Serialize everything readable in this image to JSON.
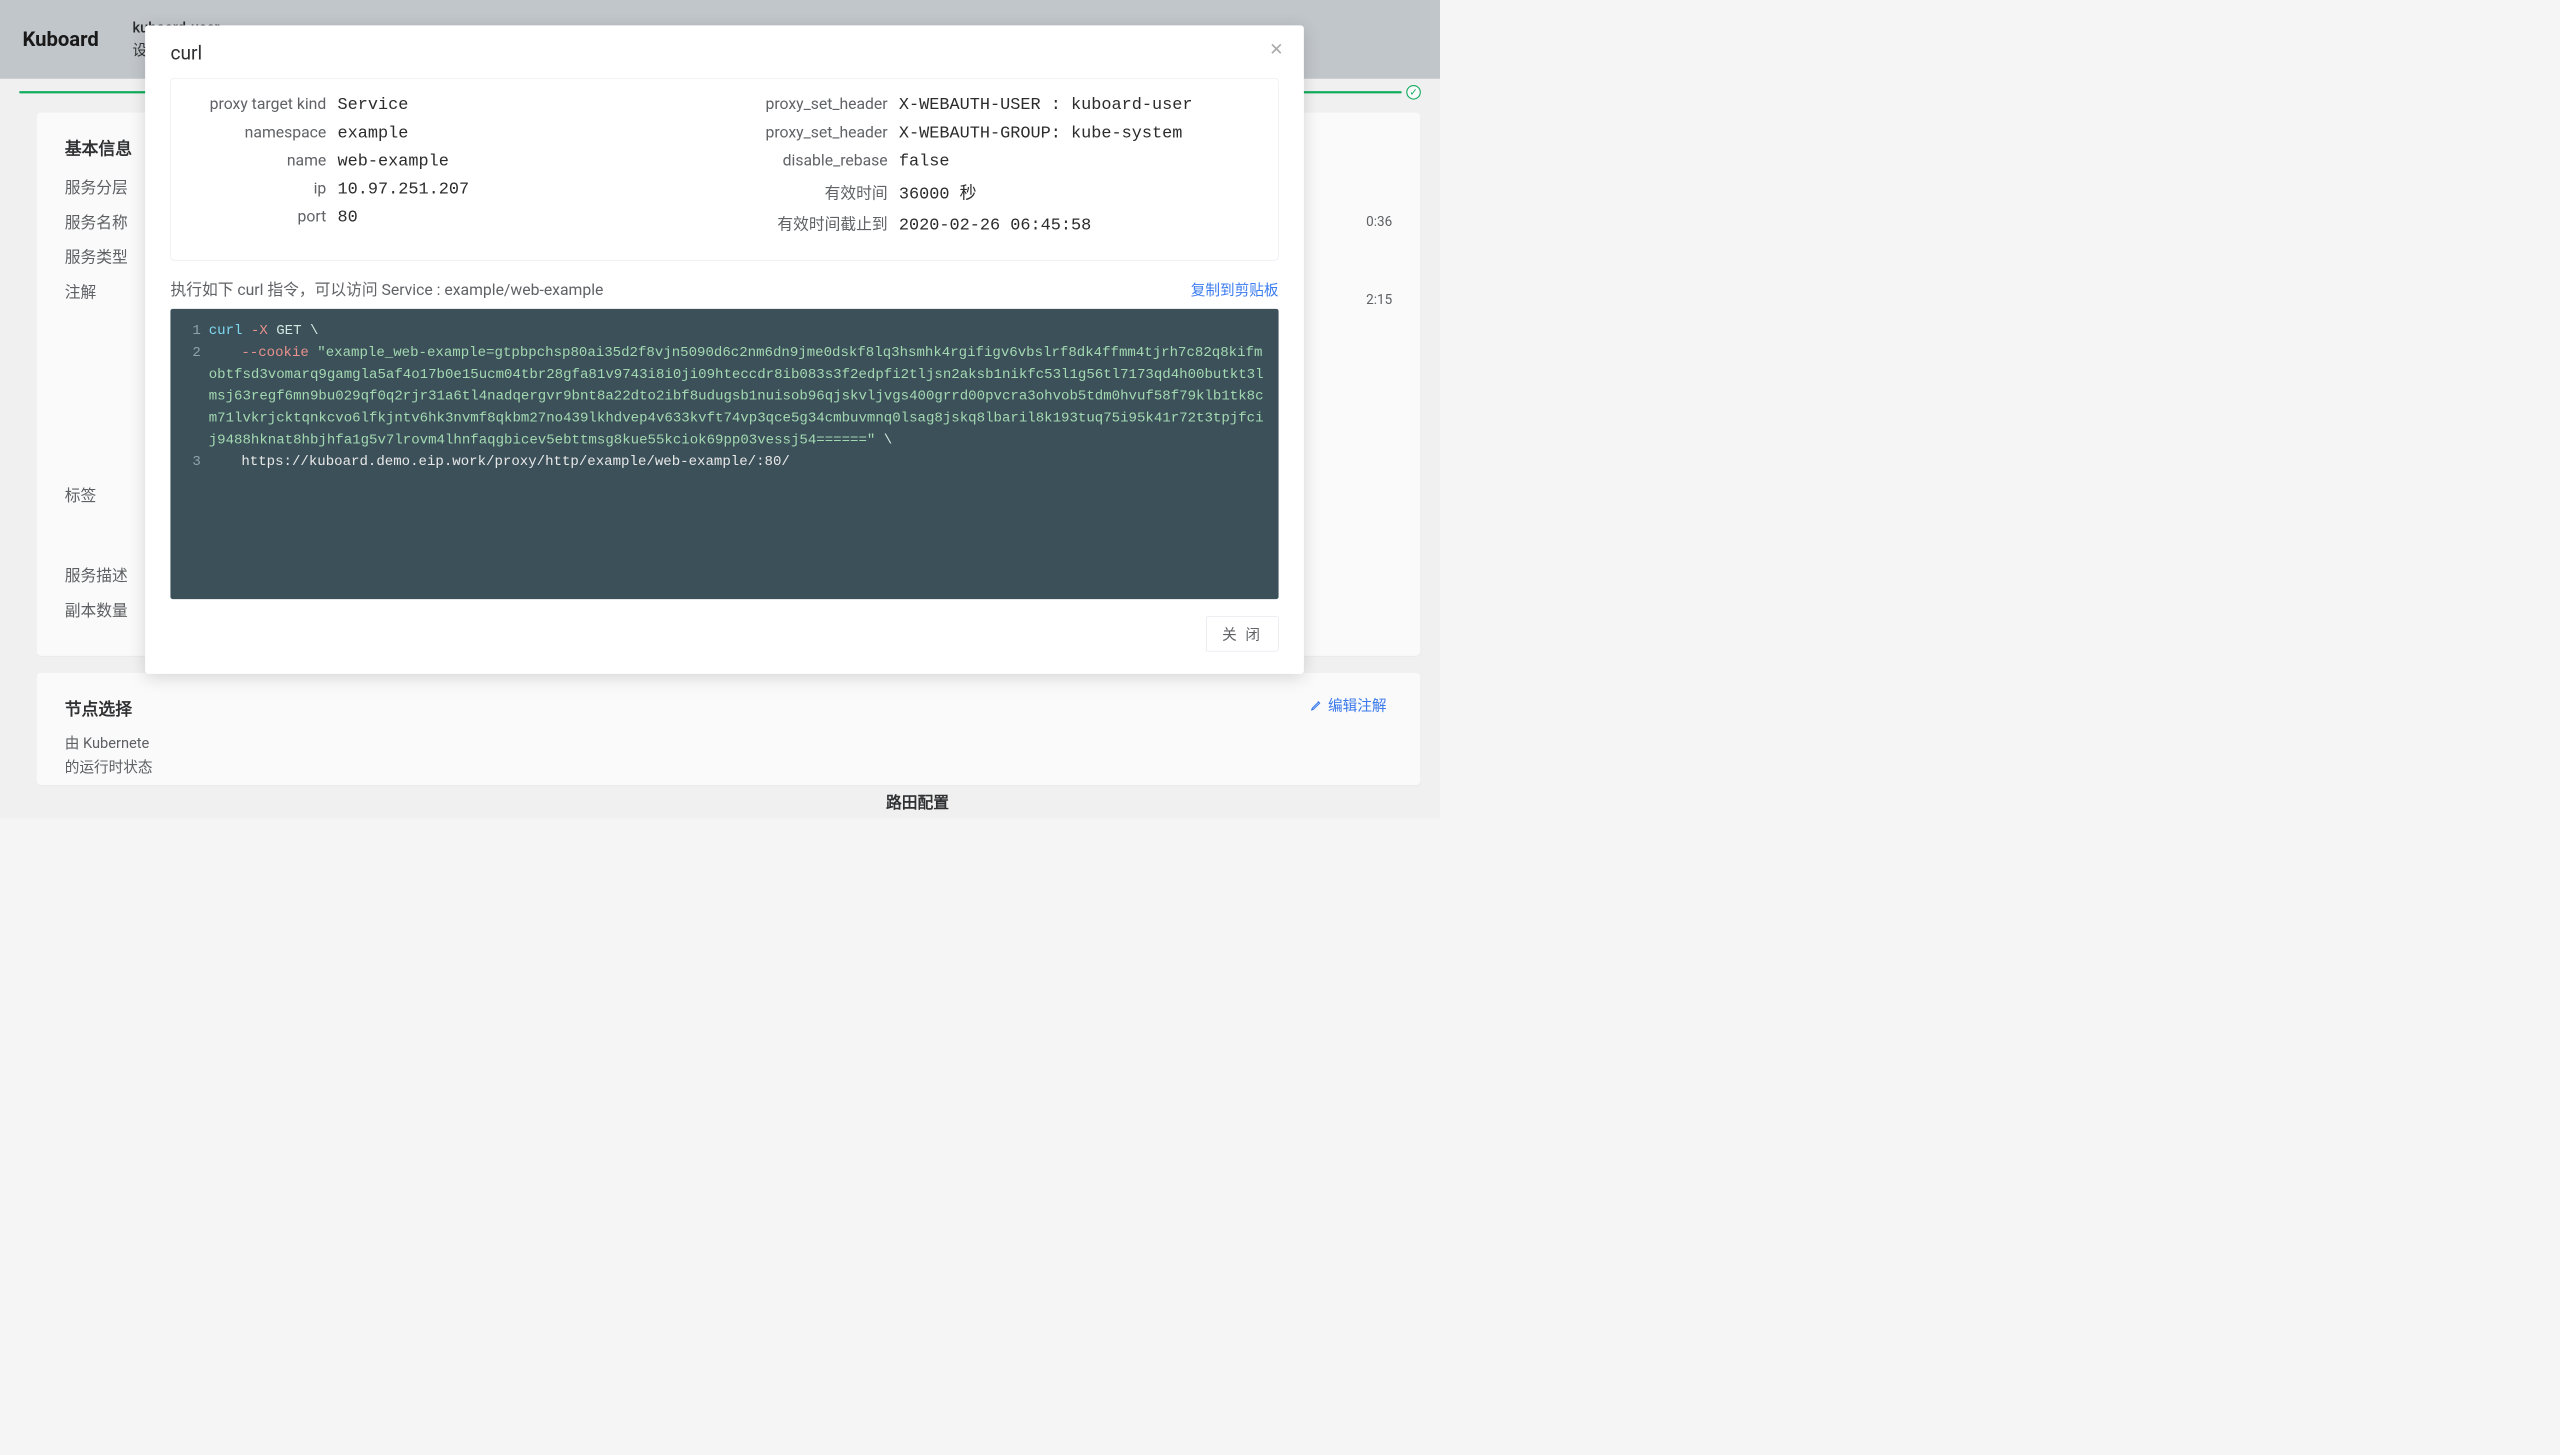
{
  "brand": "Kuboard",
  "user": {
    "name": "kuboard-user",
    "settings_label": "设置"
  },
  "background": {
    "card1_title": "基本信息",
    "rows": [
      "服务分层",
      "服务名称",
      "服务类型",
      "注解",
      "标签",
      "服务描述",
      "副本数量"
    ],
    "meta_time1": "0:36",
    "meta_time2": "2:15",
    "card2_title": "节点选择",
    "card2_line1": "由 Kubernete",
    "card2_line2": "的运行时状态",
    "edit_anno": "编辑注解",
    "route_label": "路田配置"
  },
  "modal": {
    "title": "curl",
    "left_kv": [
      {
        "k": "proxy target kind",
        "v": "Service"
      },
      {
        "k": "namespace",
        "v": "example"
      },
      {
        "k": "name",
        "v": "web-example"
      },
      {
        "k": "ip",
        "v": "10.97.251.207"
      },
      {
        "k": "port",
        "v": "80"
      }
    ],
    "right_kv": [
      {
        "k": "proxy_set_header",
        "v": "X-WEBAUTH-USER : kuboard-user"
      },
      {
        "k": "proxy_set_header",
        "v": "X-WEBAUTH-GROUP: kube-system"
      },
      {
        "k": "disable_rebase",
        "v": "false"
      },
      {
        "k": "有效时间",
        "v": "36000 秒"
      },
      {
        "k": "有效时间截止到",
        "v": "2020-02-26 06:45:58"
      }
    ],
    "instruction": "执行如下 curl 指令，可以访问 Service : example/web-example",
    "copy_label": "复制到剪贴板",
    "code": {
      "l1_curl": "curl",
      "l1_flag": "-X",
      "l1_method": "GET",
      "l1_slash": "\\",
      "l2_flag": "--cookie",
      "l2_str_start": "\"example_web-",
      "l2_body": "example=gtpbpchsp80ai35d2f8vjn5090d6c2nm6dn9jme0dskf8lq3hsmhk4rgifigv6vbslrf8dk4ffmm4tjrh7c82q8kifmobtfsd3vomarq9gamgla5af4o17b0e15ucm04tbr28gfa81v9743i8i0ji09hteccdr8ib083s3f2edpfi2tljsn2aksb1nikfc53l1g56tl7173qd4h00butkt3lmsj63regf6mn9bu029qf0q2rjr31a6tl4nadqergvr9bnt8a22dto2ibf8udugsb1nuisob96qjskvljvgs400grrd00pvcra3ohvob5tdm0hvuf58f79klb1tk8cm71lvkrjcktqnkcvo6lfkjntv6hk3nvmf8qkbm27no439lkhdvep4v633kvft74vp3qce5g34cmbuvmnq0lsag8jskq8lbaril8k193tuq75i95k41r72t3tpjfcij9488hknat8hbjhfa1g5v7lrovm4lhnfaqgbicev5ebttmsg8kue55kciok69pp03vessj54======\"",
      "l2_slash": "\\",
      "l3_url": "https://kuboard.demo.eip.work/proxy/http/example/web-example/:80/"
    },
    "close_button": "关 闭"
  }
}
